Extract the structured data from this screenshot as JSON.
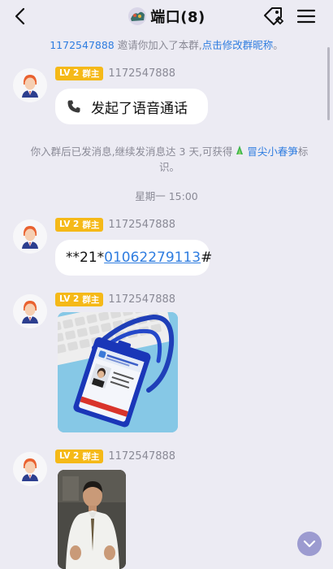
{
  "header": {
    "title": "端口(8)",
    "icons": {
      "back": "chevron-left-icon",
      "group": "group-avatar-icon",
      "settings": "tag-settings-icon",
      "menu": "hamburger-menu-icon"
    }
  },
  "top_notice": {
    "user_id": "1172547888",
    "text": " 邀请你加入了本群,",
    "link": "点击修改群昵称",
    "suffix": "。"
  },
  "messages": [
    {
      "level": "LV 2",
      "role": "群主",
      "sender": "1172547888",
      "text": "发起了语音通话",
      "icon": "phone-icon"
    },
    {
      "level": "LV 2",
      "role": "群主",
      "sender": "1172547888",
      "text_prefix": "**21*",
      "phone_link": "01062279113",
      "text_suffix": "#"
    },
    {
      "level": "LV 2",
      "role": "群主",
      "sender": "1172547888",
      "image": "id-badge-lanyard-photo"
    },
    {
      "level": "LV 2",
      "role": "群主",
      "sender": "1172547888",
      "image": "man-in-shirt-photo"
    }
  ],
  "system_notice": {
    "text": "你入群后已发消息,继续发消息达 3 天,可获得 ",
    "link": "冒尖小春笋",
    "suffix": "标识。"
  },
  "timestamp": "星期一 15:00",
  "colors": {
    "background": "#ecebf3",
    "link": "#2f7de0",
    "badge": "#f5b918",
    "scroll_button": "#9c9bd0"
  }
}
